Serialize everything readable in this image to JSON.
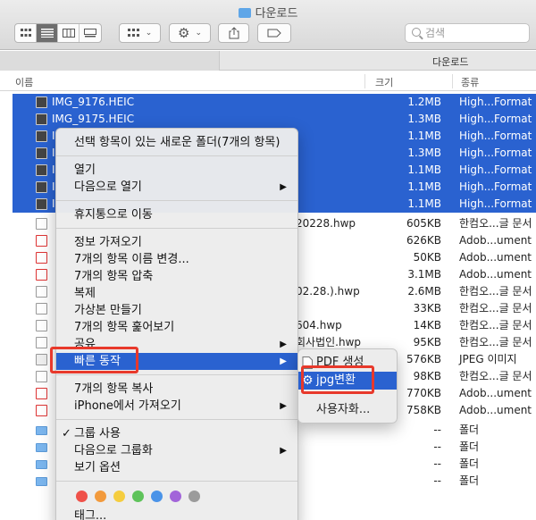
{
  "window": {
    "title": "다운로드"
  },
  "toolbar": {
    "search_placeholder": "검색",
    "view_modes": [
      "icon-view",
      "list-view",
      "column-view",
      "gallery-view"
    ],
    "active_view": "list-view"
  },
  "pathbar": {
    "label": "다운로드"
  },
  "columns": {
    "name": "이름",
    "size": "크기",
    "kind": "종류"
  },
  "files": [
    {
      "name": "IMG_9176.HEIC",
      "size": "1.2MB",
      "kind": "High...Format",
      "icon": "image-icon",
      "selected": true
    },
    {
      "name": "IMG_9175.HEIC",
      "size": "1.3MB",
      "kind": "High...Format",
      "icon": "image-icon",
      "selected": true
    },
    {
      "name": "I",
      "size": "1.1MB",
      "kind": "High...Format",
      "icon": "image-icon",
      "selected": true
    },
    {
      "name": "I",
      "size": "1.3MB",
      "kind": "High...Format",
      "icon": "image-icon",
      "selected": true
    },
    {
      "name": "I",
      "size": "1.1MB",
      "kind": "High...Format",
      "icon": "image-icon",
      "selected": true
    },
    {
      "name": "I",
      "size": "1.1MB",
      "kind": "High...Format",
      "icon": "image-icon",
      "selected": true
    },
    {
      "name": "I",
      "size": "1.1MB",
      "kind": "High...Format",
      "icon": "image-icon",
      "selected": true
    },
    {
      "name": "20228.hwp",
      "size": "605KB",
      "kind": "한컴오...글 문서",
      "icon": "document-icon",
      "selected": false
    },
    {
      "name": "",
      "size": "626KB",
      "kind": "Adob...ument",
      "icon": "pdf-icon",
      "selected": false
    },
    {
      "name": "",
      "size": "50KB",
      "kind": "Adob...ument",
      "icon": "pdf-icon",
      "selected": false
    },
    {
      "name": "",
      "size": "3.1MB",
      "kind": "Adob...ument",
      "icon": "pdf-icon",
      "selected": false
    },
    {
      "name": "02.28.).hwp",
      "size": "2.6MB",
      "kind": "한컴오...글 문서",
      "icon": "document-icon",
      "selected": false
    },
    {
      "name": "",
      "size": "33KB",
      "kind": "한컴오...글 문서",
      "icon": "document-icon",
      "selected": false
    },
    {
      "name": "604.hwp",
      "size": "14KB",
      "kind": "한컴오...글 문서",
      "icon": "document-icon",
      "selected": false
    },
    {
      "name": "회사법인.hwp",
      "size": "95KB",
      "kind": "한컴오...글 문서",
      "icon": "document-icon",
      "selected": false
    },
    {
      "name": "",
      "size": "576KB",
      "kind": "JPEG 이미지",
      "icon": "jpeg-icon",
      "selected": false
    },
    {
      "name": "",
      "size": "98KB",
      "kind": "한컴오...글 문서",
      "icon": "document-icon",
      "selected": false
    },
    {
      "name": "",
      "size": "770KB",
      "kind": "Adob...ument",
      "icon": "pdf-icon",
      "selected": false
    },
    {
      "name": "",
      "size": "758KB",
      "kind": "Adob...ument",
      "icon": "pdf-icon",
      "selected": false
    },
    {
      "name": "",
      "size": "--",
      "kind": "폴더",
      "icon": "folder-icon",
      "selected": false
    },
    {
      "name": "",
      "size": "--",
      "kind": "폴더",
      "icon": "folder-icon",
      "selected": false
    },
    {
      "name": "",
      "size": "--",
      "kind": "폴더",
      "icon": "folder-icon",
      "selected": false
    },
    {
      "name": "",
      "size": "--",
      "kind": "폴더",
      "icon": "folder-icon",
      "selected": false
    }
  ],
  "context_menu": {
    "new_folder": "선택 항목이 있는 새로운 폴더(7개의 항목)",
    "open": "열기",
    "open_with": "다음으로 열기",
    "trash": "휴지통으로 이동",
    "get_info": "정보 가져오기",
    "rename": "7개의 항목 이름 변경...",
    "compress": "7개의 항목 압축",
    "duplicate": "복제",
    "make_alias": "가상본 만들기",
    "quick_look": "7개의 항목 훑어보기",
    "share": "공유",
    "quick_actions": "빠른 동작",
    "copy": "7개의 항목 복사",
    "import_iphone": "iPhone에서 가져오기",
    "use_groups": "그룹 사용",
    "group_by": "다음으로 그룹화",
    "view_options": "보기 옵션",
    "tags": "태그...",
    "tag_colors": [
      "#ef5149",
      "#f29a3c",
      "#f5cd3f",
      "#5ec35a",
      "#4a93e8",
      "#a264d9",
      "#9b9b9b"
    ]
  },
  "submenu": {
    "create_pdf": "PDF 생성",
    "jpg_convert": "jpg변환",
    "customize": "사용자화..."
  }
}
